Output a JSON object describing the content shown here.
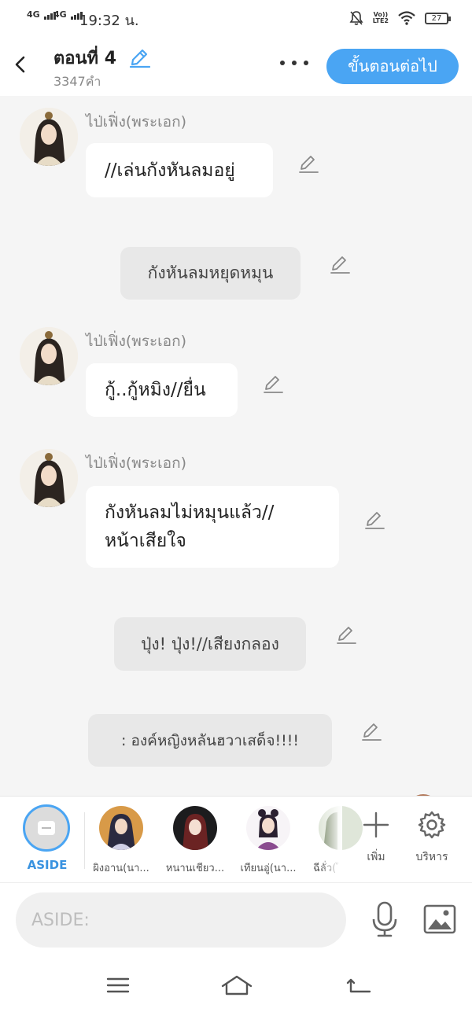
{
  "status_bar": {
    "sim1": "4G",
    "sim2": "4G",
    "time": "19:32 น.",
    "volte_top": "Vo))",
    "volte_bottom": "LTE2",
    "battery": "27"
  },
  "header": {
    "title": "ตอนที่ 4",
    "word_count": "3347คำ",
    "next_button": "ขั้นตอนต่อไป"
  },
  "messages": [
    {
      "type": "dialogue",
      "name": "ไป่เฟิ่ง(พระเอก)",
      "lines": [
        "//เล่นกังหันลมอยู่"
      ]
    },
    {
      "type": "narration",
      "text": "กังหันลมหยุดหมุน"
    },
    {
      "type": "dialogue",
      "name": "ไป่เฟิ่ง(พระเอก)",
      "lines": [
        "กู้..กู้หมิง//ยื่น"
      ]
    },
    {
      "type": "dialogue",
      "name": "ไป่เฟิ่ง(พระเอก)",
      "lines": [
        "กังหันลมไม่หมุนแล้ว//",
        "หน้าเสียใจ"
      ]
    },
    {
      "type": "narration",
      "text": "ปุ่ง! ปุ่ง!//เสียงกลอง"
    },
    {
      "type": "narration",
      "text": ": องค์หญิงหลันฮวาเสด็จ!!!!"
    }
  ],
  "characters": {
    "aside_label": "ASIDE",
    "items": [
      "ผิงอาน(นา...",
      "หนานเชียว...",
      "เทียนอู่(นา...",
      "ฉีลั่ว(ไ"
    ],
    "add_label": "เพิ่ม",
    "manage_label": "บริหาร"
  },
  "input": {
    "placeholder": "ASIDE:"
  },
  "colors": {
    "accent": "#4aa5f3",
    "background": "#f5f5f5",
    "narration_bg": "#e8e8e8"
  }
}
